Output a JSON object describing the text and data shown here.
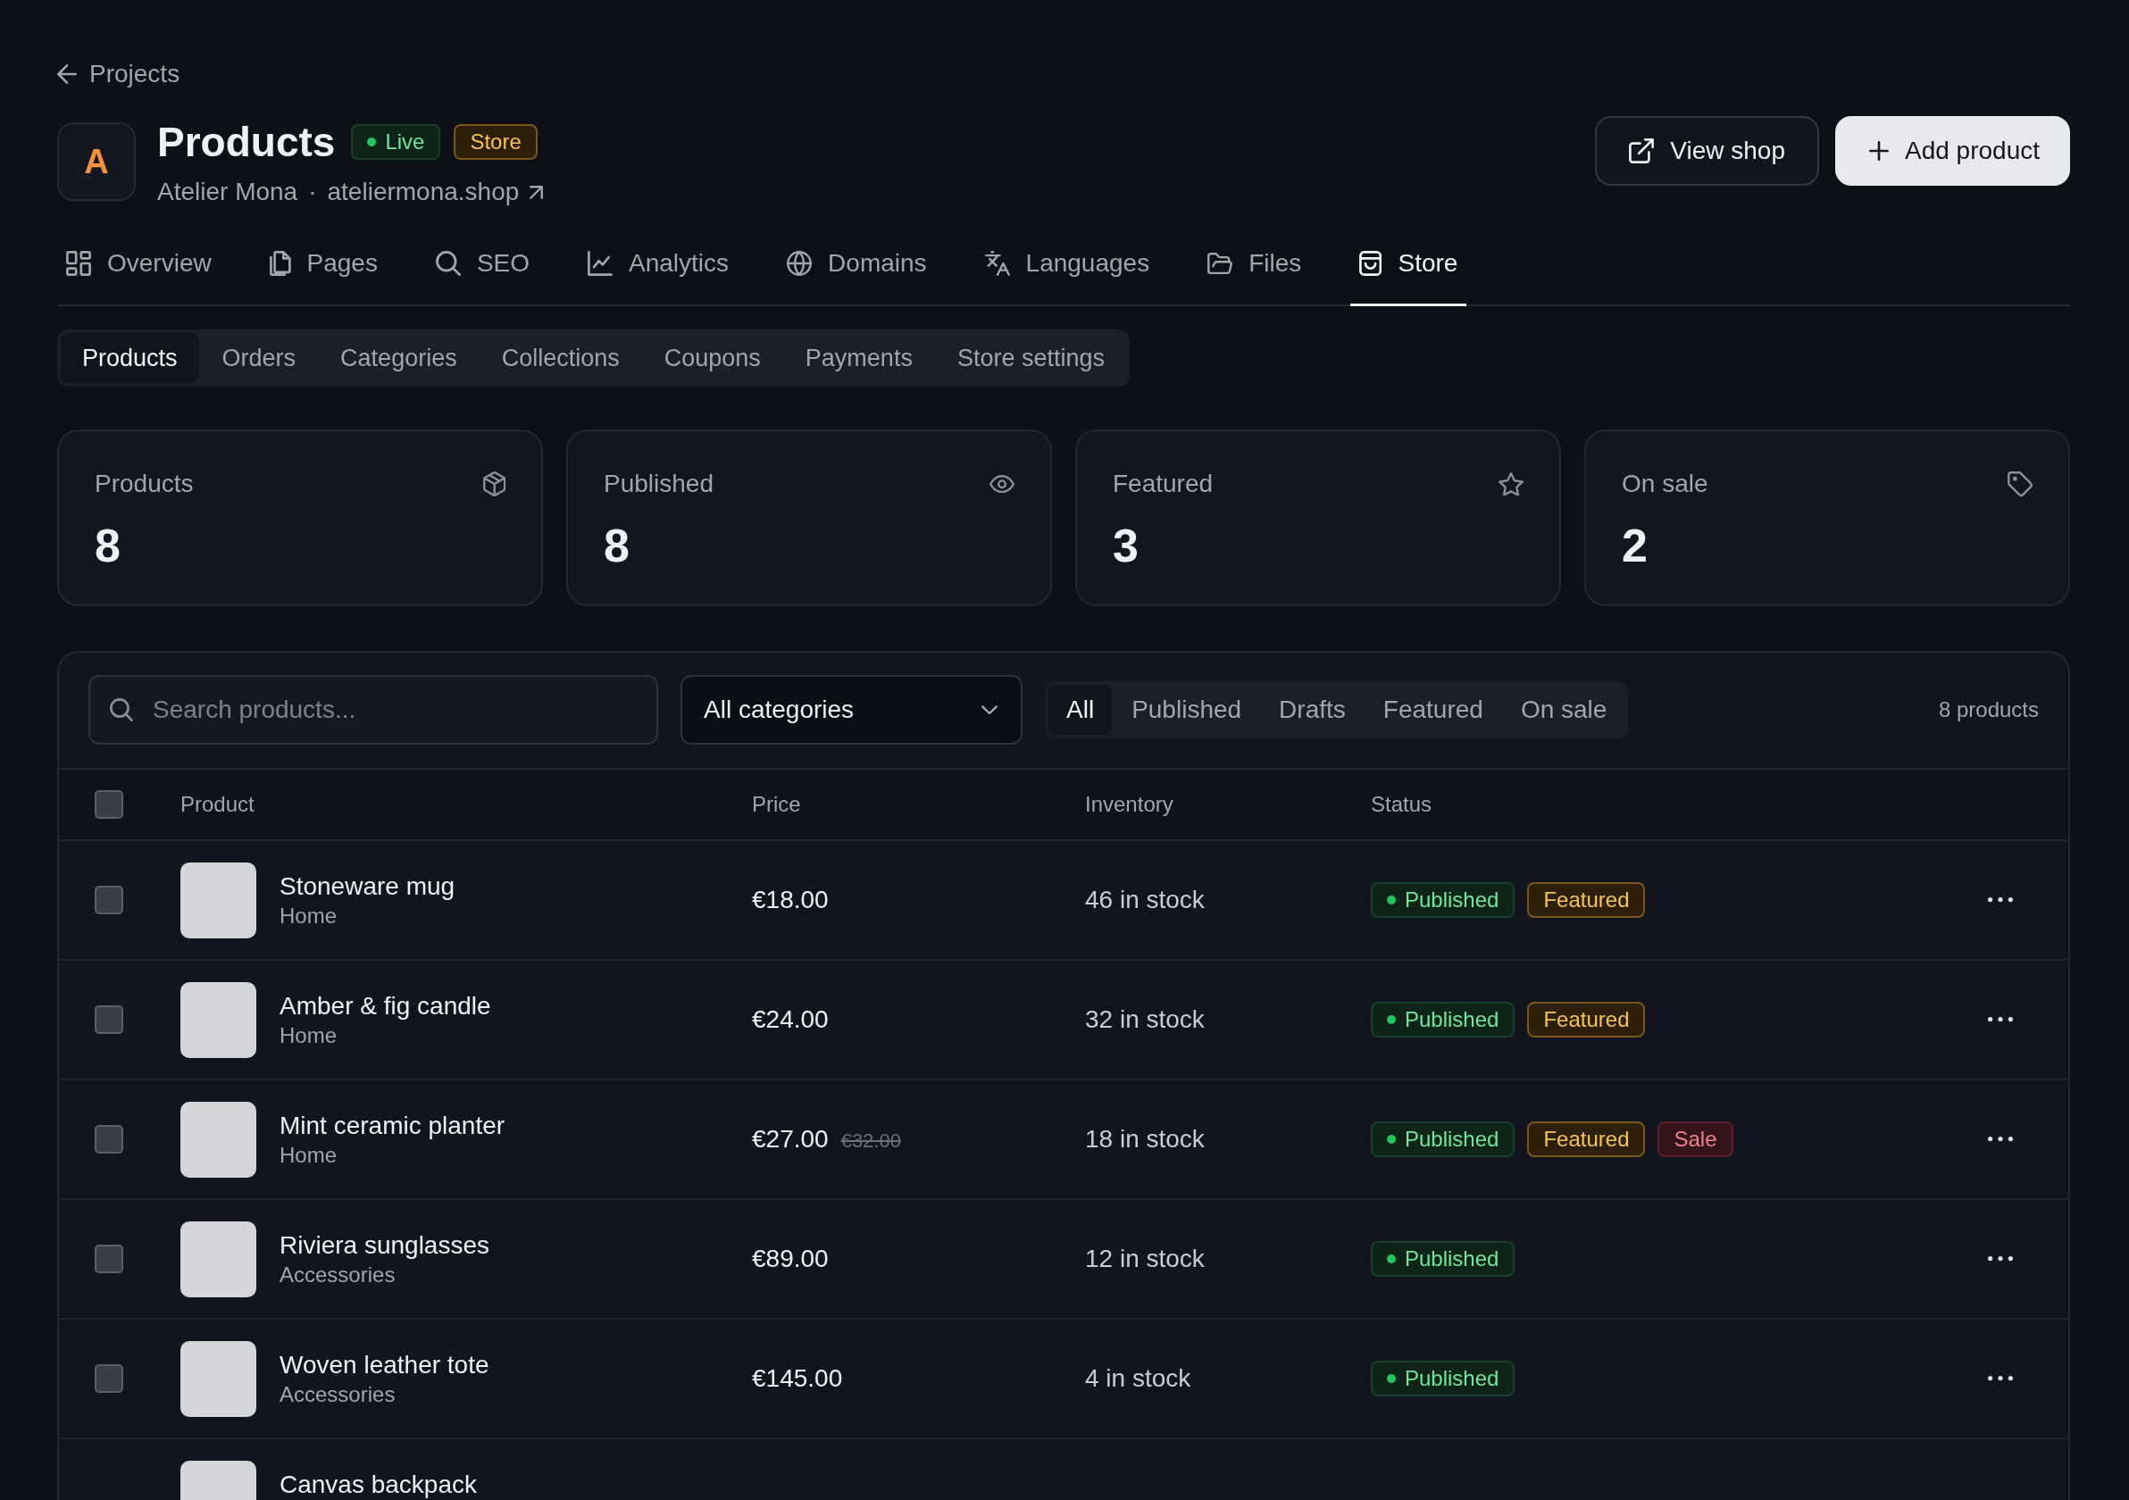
{
  "back_link": {
    "label": "Projects"
  },
  "header": {
    "avatar": "A",
    "title": "Products",
    "badges": [
      {
        "label": "Live",
        "kind": "live"
      },
      {
        "label": "Store",
        "kind": "store"
      }
    ],
    "store_name": "Atelier Mona",
    "separator": "·",
    "domain": "ateliermona.shop"
  },
  "actions": [
    {
      "label": "View shop",
      "kind": "secondary"
    },
    {
      "label": "Add product",
      "kind": "primary"
    }
  ],
  "tabs": [
    {
      "label": "Overview",
      "kind": "overview",
      "selected": false
    },
    {
      "label": "Pages",
      "kind": "pages",
      "selected": false
    },
    {
      "label": "SEO",
      "kind": "seo",
      "selected": false
    },
    {
      "label": "Analytics",
      "kind": "analytics",
      "selected": false
    },
    {
      "label": "Domains",
      "kind": "domains",
      "selected": false
    },
    {
      "label": "Languages",
      "kind": "languages",
      "selected": false
    },
    {
      "label": "Files",
      "kind": "files",
      "selected": false
    },
    {
      "label": "Store",
      "kind": "store",
      "selected": true
    }
  ],
  "subtabs": [
    {
      "label": "Products",
      "selected": true
    },
    {
      "label": "Orders",
      "selected": false
    },
    {
      "label": "Categories",
      "selected": false
    },
    {
      "label": "Collections",
      "selected": false
    },
    {
      "label": "Coupons",
      "selected": false
    },
    {
      "label": "Payments",
      "selected": false
    },
    {
      "label": "Store settings",
      "selected": false
    }
  ],
  "stats": [
    {
      "label": "Products",
      "value": "8",
      "kind": "products"
    },
    {
      "label": "Published",
      "value": "8",
      "kind": "published"
    },
    {
      "label": "Featured",
      "value": "3",
      "kind": "featured"
    },
    {
      "label": "On sale",
      "value": "2",
      "kind": "sale"
    }
  ],
  "table": {
    "search": {
      "placeholder": "Search products..."
    },
    "category_filter": {
      "value": "All categories"
    },
    "filters": [
      {
        "label": "All",
        "selected": true
      },
      {
        "label": "Published",
        "selected": false
      },
      {
        "label": "Drafts",
        "selected": false
      },
      {
        "label": "Featured",
        "selected": false
      },
      {
        "label": "On sale",
        "selected": false
      }
    ],
    "count": "8 products",
    "select_all": {
      "checked": false
    },
    "columns": [
      "Product",
      "Price",
      "Inventory",
      "Status"
    ],
    "rows": [
      {
        "checked": false,
        "name": "Stoneware mug",
        "category": "Home",
        "price": "€18.00",
        "inventory": "46 in stock",
        "badges": [
          {
            "label": "Published",
            "kind": "published"
          },
          {
            "label": "Featured",
            "kind": "featured"
          }
        ]
      },
      {
        "checked": false,
        "name": "Amber & fig candle",
        "category": "Home",
        "price": "€24.00",
        "inventory": "32 in stock",
        "badges": [
          {
            "label": "Published",
            "kind": "published"
          },
          {
            "label": "Featured",
            "kind": "featured"
          }
        ]
      },
      {
        "checked": false,
        "name": "Mint ceramic planter",
        "category": "Home",
        "price": "€27.00",
        "compare_price": "€32.00",
        "inventory": "18 in stock",
        "badges": [
          {
            "label": "Published",
            "kind": "published"
          },
          {
            "label": "Featured",
            "kind": "featured"
          },
          {
            "label": "Sale",
            "kind": "sale"
          }
        ]
      },
      {
        "checked": false,
        "name": "Riviera sunglasses",
        "category": "Accessories",
        "price": "€89.00",
        "inventory": "12 in stock",
        "badges": [
          {
            "label": "Published",
            "kind": "published"
          }
        ]
      },
      {
        "checked": false,
        "name": "Woven leather tote",
        "category": "Accessories",
        "price": "€145.00",
        "inventory": "4 in stock",
        "badges": [
          {
            "label": "Published",
            "kind": "published"
          }
        ]
      },
      {
        "name": "Canvas backpack"
      }
    ]
  }
}
